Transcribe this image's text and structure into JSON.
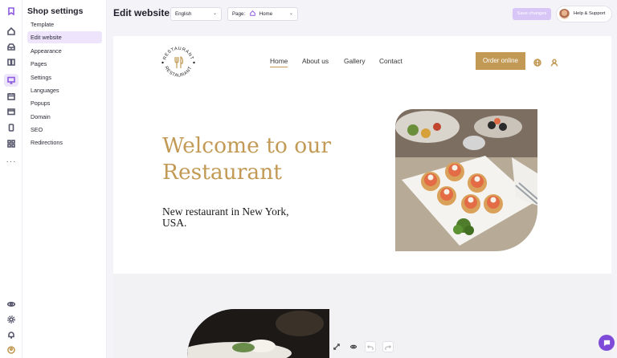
{
  "sidebar": {
    "title": "Shop settings",
    "items": [
      {
        "label": "Template"
      },
      {
        "label": "Edit website"
      },
      {
        "label": "Appearance"
      },
      {
        "label": "Pages"
      },
      {
        "label": "Settings"
      },
      {
        "label": "Languages"
      },
      {
        "label": "Popups"
      },
      {
        "label": "Domain"
      },
      {
        "label": "SEO"
      },
      {
        "label": "Redirections"
      }
    ],
    "active_item": "Edit website"
  },
  "rail": {
    "icons": [
      "logo-icon",
      "home-icon",
      "inbox-icon",
      "book-icon",
      "monitor-icon",
      "calendar-icon",
      "wallet-icon",
      "mobile-icon",
      "apps-icon",
      "more-icon",
      "eye-icon",
      "gear-icon",
      "bell-icon",
      "avatar-icon"
    ],
    "active_icon": "monitor-icon",
    "more_label": "···"
  },
  "topbar": {
    "title": "Edit website",
    "language": "English",
    "page_label": "Page:",
    "page_value": "Home",
    "save_label": "Save changes",
    "help_label": "Help & Support"
  },
  "site": {
    "logo_text_top": "RESTAURANT",
    "logo_text_bottom": "RESTAURANT",
    "nav": [
      "Home",
      "About us",
      "Gallery",
      "Contact"
    ],
    "active_nav": "Home",
    "order_label": "Order online",
    "hero_heading": "Welcome to our Restaurant",
    "hero_subheading": "New restaurant in New York, USA."
  },
  "colors": {
    "accent_gold": "#c29a55",
    "brand_purple": "#7e4bd8",
    "active_bg": "#eee5fd"
  }
}
